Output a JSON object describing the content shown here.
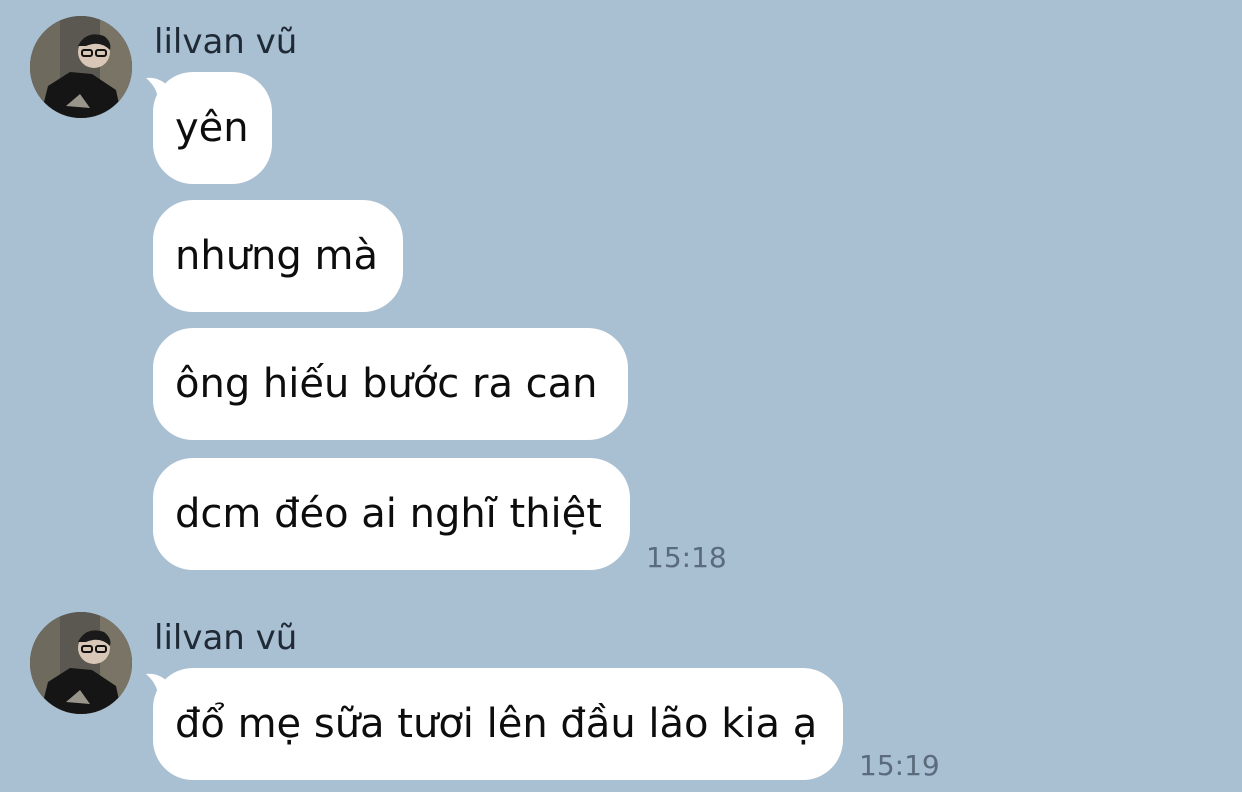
{
  "colors": {
    "background": "#a9bfd2",
    "bubble": "#ffffff",
    "text": "#0d0d0d",
    "sender": "#1f2a36",
    "timestamp": "#5a6b7c"
  },
  "groups": [
    {
      "sender": "lilvan vũ",
      "avatar_icon": "user-avatar-photo",
      "messages": [
        "yên",
        "nhưng mà",
        "ông hiếu bước ra can",
        "dcm đéo ai nghĩ thiệt"
      ],
      "time": "15:18"
    },
    {
      "sender": "lilvan vũ",
      "avatar_icon": "user-avatar-photo",
      "messages": [
        "đổ mẹ sữa tươi lên đầu lão kia ạ"
      ],
      "time": "15:19"
    }
  ]
}
